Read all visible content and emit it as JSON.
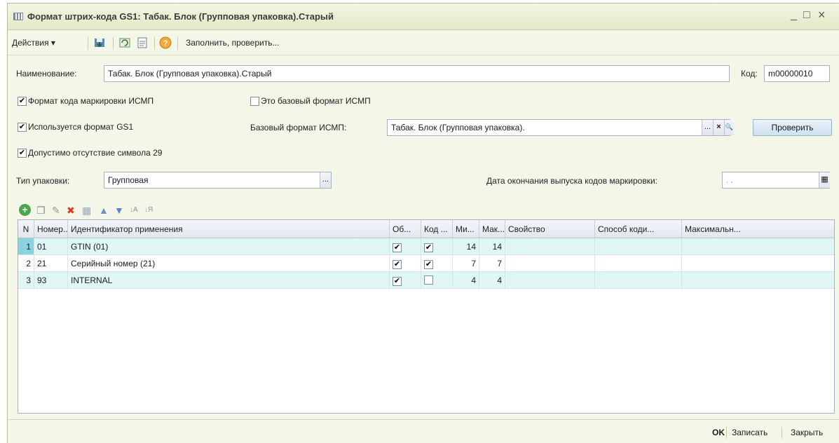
{
  "window": {
    "title": "Формат штрих-кода GS1: Табак. Блок (Групповая упаковка).Старый",
    "minimize": "_",
    "maximize": "□",
    "close": "×"
  },
  "toolbar": {
    "actions_label": "Действия",
    "actions_arrow": "▾",
    "help_glyph": "?",
    "fill_check_label": "Заполнить, проверить..."
  },
  "form": {
    "name_label": "Наименование:",
    "name_value": "Табак. Блок (Групповая упаковка).Старый",
    "code_label": "Код:",
    "code_value": "m00000010",
    "format_ismp_label": "Формат кода маркировки ИСМП",
    "format_ismp_checked": "✔",
    "base_format_flag_label": "Это базовый формат ИСМП",
    "base_format_flag_checked": "",
    "gs1_used_label": "Используется формат GS1",
    "gs1_used_checked": "✔",
    "base_format_label": "Базовый формат ИСМП:",
    "base_format_value": "Табак. Блок (Групповая упаковка).",
    "base_format_select": "...",
    "base_format_clear": "×",
    "base_format_open": "🔍",
    "check_button": "Проверить",
    "allow_no_29_label": "Допустимо отсутствие символа 29",
    "allow_no_29_checked": "✔",
    "pack_type_label": "Тип упаковки:",
    "pack_type_value": "Групповая",
    "pack_type_select": "...",
    "end_date_label": "Дата окончания выпуска кодов маркировки:",
    "end_date_value": ". .",
    "calendar_glyph": "▦"
  },
  "grid_toolbar": {
    "add": "+",
    "copy": "❐",
    "edit": "✎",
    "delete": "✖",
    "end_edit": "▦",
    "move_up": "▲",
    "move_down": "▼",
    "sort_asc": "↓A",
    "sort_desc": "↓Я"
  },
  "table": {
    "columns": [
      "N",
      "Номер...",
      "Идентификатор применения",
      "Об...",
      "Код ...",
      "Ми...",
      "Мак...",
      "Свойство",
      "Способ коди...",
      "Максимальн..."
    ],
    "rows": [
      {
        "n": "1",
        "number": "01",
        "ident": "GTIN (01)",
        "ob": "✔",
        "kod": "✔",
        "min": "14",
        "max": "14",
        "prop": "",
        "method": "",
        "maxv": ""
      },
      {
        "n": "2",
        "number": "21",
        "ident": "Серийный номер (21)",
        "ob": "✔",
        "kod": "✔",
        "min": "7",
        "max": "7",
        "prop": "",
        "method": "",
        "maxv": ""
      },
      {
        "n": "3",
        "number": "93",
        "ident": "INTERNAL",
        "ob": "✔",
        "kod": "",
        "min": "4",
        "max": "4",
        "prop": "",
        "method": "",
        "maxv": ""
      }
    ]
  },
  "footer": {
    "ok": "OK",
    "save": "Записать",
    "close": "Закрыть"
  },
  "colors": {
    "window_bg": "#f4f6e8",
    "row_highlight": "#dff7f5",
    "button_blue": "#cfe0f0"
  }
}
